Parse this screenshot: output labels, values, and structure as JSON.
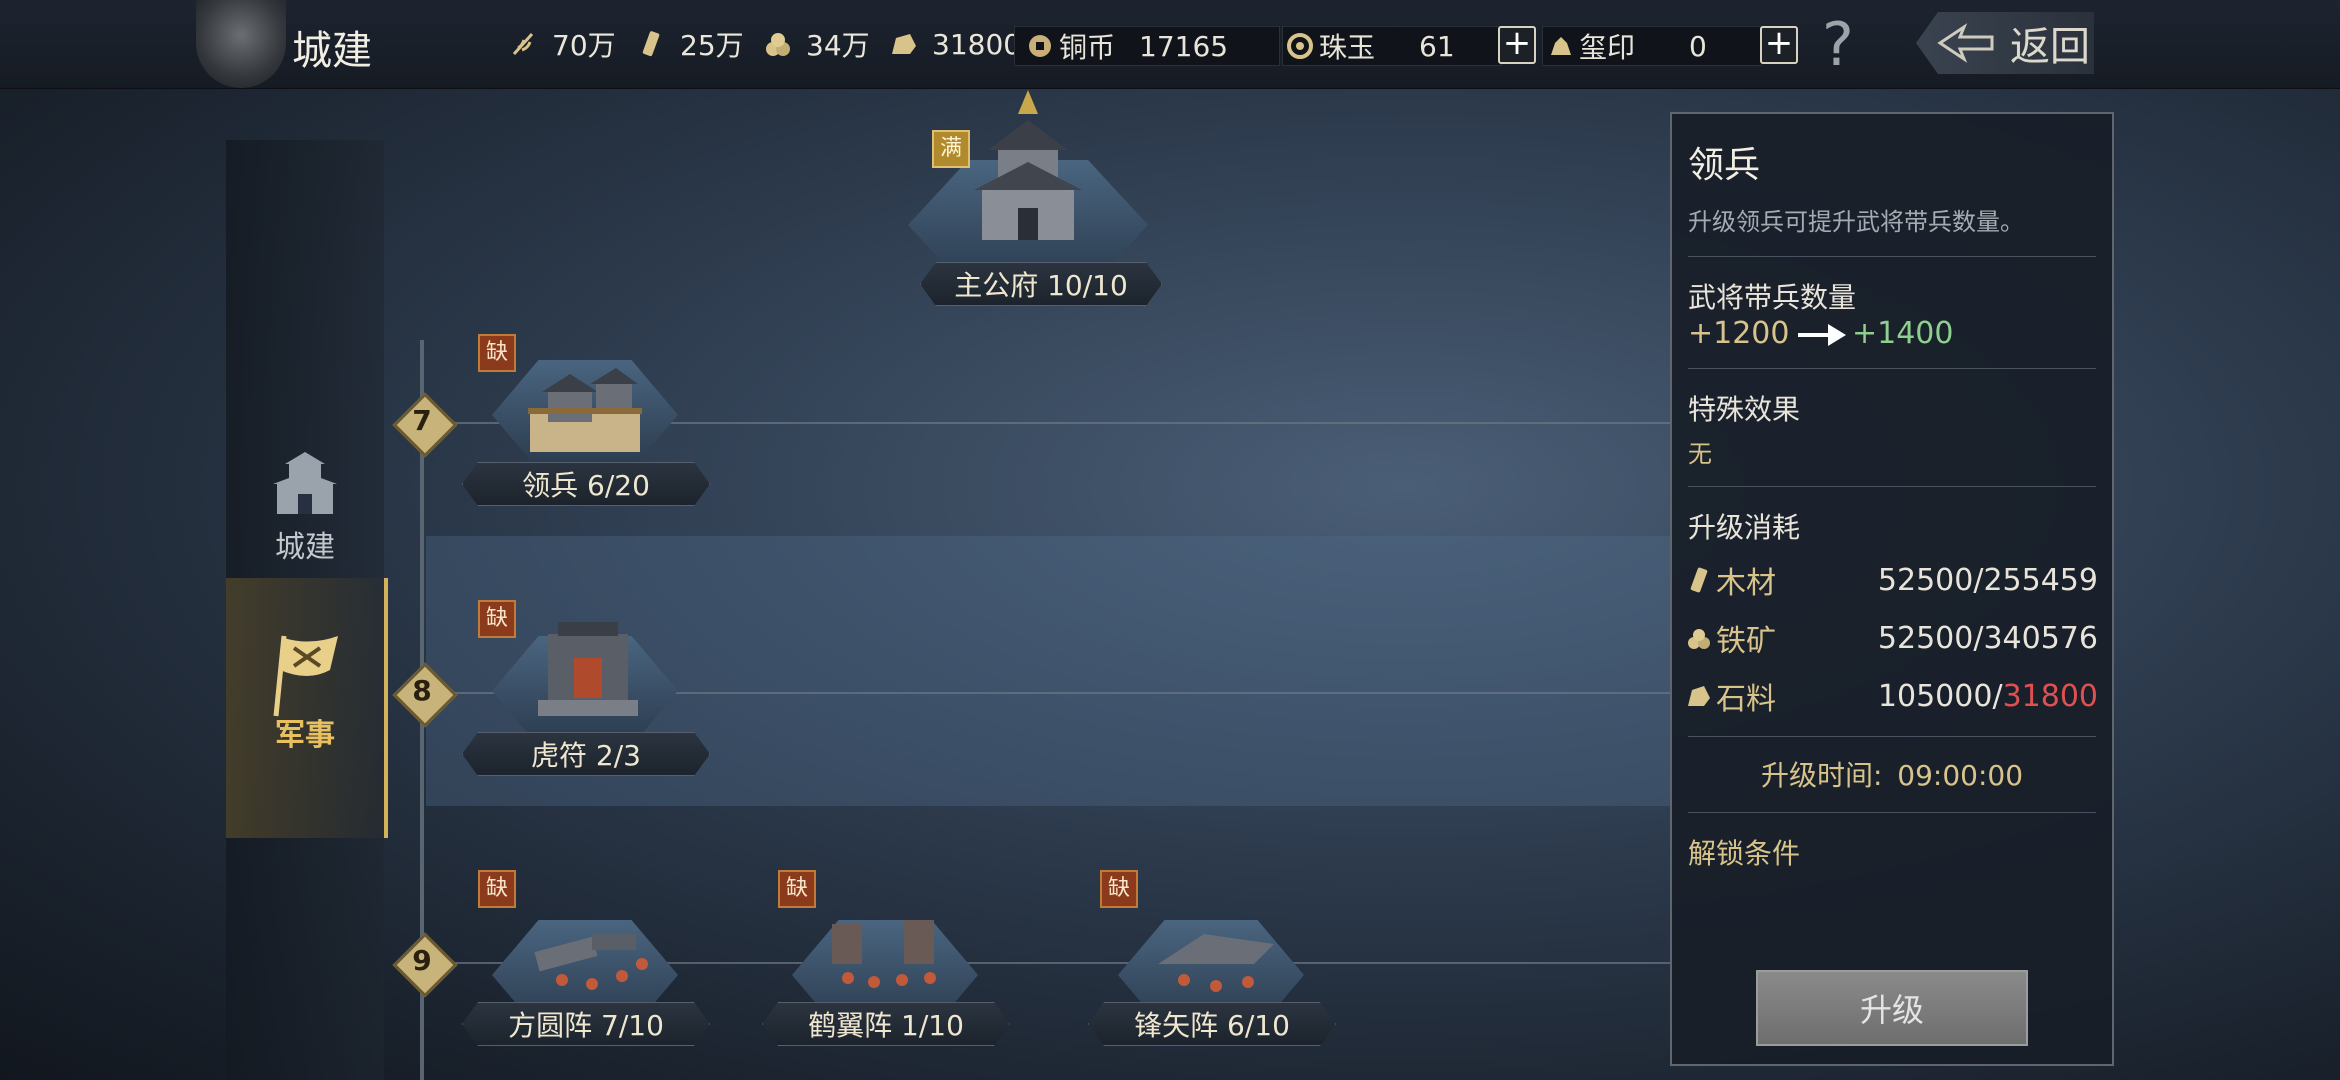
{
  "header": {
    "title": "城建",
    "resources": [
      {
        "icon": "grain-icon",
        "value": "70万"
      },
      {
        "icon": "wood-icon",
        "value": "25万"
      },
      {
        "icon": "iron-icon",
        "value": "34万"
      },
      {
        "icon": "stone-icon",
        "value": "31800"
      }
    ],
    "currencies": [
      {
        "icon": "copper-coin-icon",
        "label": "铜币",
        "value": "17165"
      },
      {
        "icon": "jade-icon",
        "label": "珠玉",
        "value": "61"
      },
      {
        "icon": "seal-icon",
        "label": "玺印",
        "value": "0"
      }
    ],
    "help": "?",
    "back": "返回"
  },
  "nav": {
    "items": [
      {
        "label": "城建",
        "icon": "city-gate-icon"
      },
      {
        "label": "军事",
        "icon": "war-flag-icon"
      }
    ]
  },
  "tree": {
    "levels": [
      "7",
      "8",
      "9"
    ],
    "buildings": {
      "main": {
        "name": "主公府 10/10",
        "tag": "满"
      },
      "lingbing": {
        "name": "领兵 6/20",
        "tag": "缺"
      },
      "hufu": {
        "name": "虎符 2/3",
        "tag": "缺"
      },
      "fangyuan": {
        "name": "方圆阵 7/10",
        "tag": "缺"
      },
      "heyi": {
        "name": "鹤翼阵 1/10",
        "tag": "缺"
      },
      "fengshi": {
        "name": "锋矢阵 6/10",
        "tag": "缺"
      }
    }
  },
  "panel": {
    "title": "领兵",
    "desc": "升级领兵可提升武将带兵数量。",
    "stat_label": "武将带兵数量",
    "stat_from": "+1200",
    "stat_to": "+1400",
    "effect_label": "特殊效果",
    "effect_value": "无",
    "cost_label": "升级消耗",
    "costs": [
      {
        "icon": "wood-icon",
        "name": "木材",
        "have": "52500/255459",
        "short": ""
      },
      {
        "icon": "iron-icon",
        "name": "铁矿",
        "have": "52500/340576",
        "short": ""
      },
      {
        "icon": "stone-icon",
        "name": "石料",
        "have": "105000/",
        "short": "31800"
      }
    ],
    "time_label": "升级时间:",
    "time_value": "09:00:00",
    "unlock_label": "解锁条件",
    "upgrade_button": "升级"
  },
  "colors": {
    "gold": "#d8c48a",
    "green": "#8fcf8f",
    "red": "#e05050",
    "nav_active": "#e8c060"
  }
}
